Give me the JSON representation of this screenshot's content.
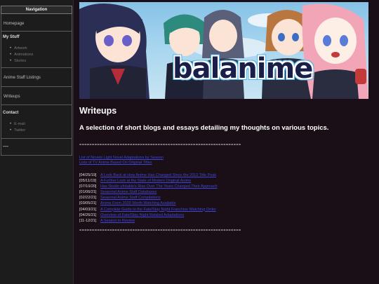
{
  "sidebar": {
    "title": "Navigation",
    "homepage": "Homepage",
    "mystuff": {
      "label": "My Stuff",
      "items": [
        "Artwork",
        "Animations",
        "Stories"
      ]
    },
    "anime_staff": "Anime Staff Listings",
    "writeups": "Writeups",
    "contact": {
      "label": "Contact",
      "items": [
        "E-mail",
        "Twitter"
      ]
    },
    "misc": "—"
  },
  "banner": {
    "logo_text": "balanime"
  },
  "main": {
    "title": "Writeups",
    "subtitle": "A selection of short blogs and essays detailing my thoughts on various topics.",
    "divider": "================================================================",
    "top_links": [
      "List of Novels Light Novel Adaptations by Season",
      "Lists of TV Anime Based On Original Titles"
    ],
    "entries": [
      {
        "date": "[04/25/19]",
        "title": "A Look Back at How Anime Has Changed Since the 2012 Title Peak"
      },
      {
        "date": "[05/11/19]",
        "title": "A Further Look at the State of Modern Original Anime"
      },
      {
        "date": "[07/10/20]",
        "title": "Has Studio ufotable's Rise Over The Years Changed Their Approach"
      },
      {
        "date": "[01/06/21]",
        "title": "Seasonal Anime Staff Databases"
      },
      {
        "date": "[02/22/21]",
        "title": "Seasonal Anime Staff Compilations"
      },
      {
        "date": "[03/05/21]",
        "title": "Anime From 2020 Worth Watching Available"
      },
      {
        "date": "[04/03/21]",
        "title": "A Complete Guide to the Fate/Stay Night Franchise Watching Order"
      },
      {
        "date": "[04/26/21]",
        "title": "Overview of Fate/Stay Night Related Adaptations"
      },
      {
        "date": "[11-12/21]",
        "title": "A Season in Review"
      }
    ]
  }
}
